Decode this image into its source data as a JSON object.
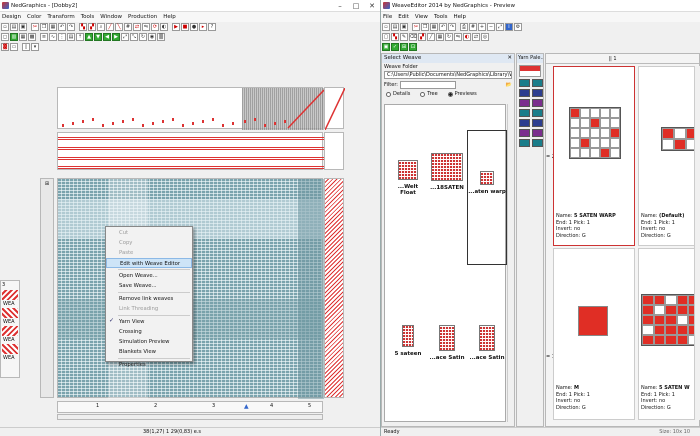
{
  "left": {
    "title": "NedGraphics - [Dobby2]",
    "menu": [
      "Design",
      "Color",
      "Transform",
      "Tools",
      "Window",
      "Production",
      "Help"
    ],
    "row_labels": [
      "3",
      "WEA",
      "WEA",
      "WEA",
      "WEA"
    ],
    "ruler_marks": [
      "1",
      "2",
      "3",
      "4",
      "5"
    ],
    "status": "38(1,27) 1 29(0,83) e.s"
  },
  "context_menu": {
    "items": [
      {
        "label": "Cut",
        "disabled": true
      },
      {
        "label": "Copy",
        "disabled": true
      },
      {
        "label": "Paste",
        "disabled": true
      },
      {
        "label": "Edit with Weave Editor",
        "highlight": true
      },
      {
        "label": "Open Weave..."
      },
      {
        "label": "Save Weave..."
      },
      {
        "label": "Remove link weaves"
      },
      {
        "label": "Link Threading",
        "disabled": true
      },
      {
        "label": "Yarn View",
        "checked": true
      },
      {
        "label": "Crossing"
      },
      {
        "label": "Simulation Preview"
      },
      {
        "label": "Blankets View"
      },
      {
        "label": "Properties"
      }
    ]
  },
  "right": {
    "title": "WeaveEditor 2014 by NedGraphics - Preview",
    "menu": [
      "File",
      "Edit",
      "View",
      "Tools",
      "Help"
    ],
    "select_weave": {
      "header": "Select Weave",
      "folder_label": "Weave Folder",
      "folder_path": "C:\\Users\\Public\\Documents\\NedGraphics\\Library\\Weaves",
      "filter_label": "Filter:",
      "modes": [
        "Details",
        "Tree",
        "Previews"
      ],
      "selected_mode": "Previews",
      "thumbs": [
        "...Welt Float",
        "...18SATEN",
        "...aten warp",
        "5 sateen",
        "...ace Satin",
        "...ace Satin"
      ]
    },
    "yarn_palette_header": "Yarn Pale...",
    "grid": {
      "col_header": "|| 1",
      "row_labels": [
        "= 2",
        "= 1"
      ],
      "cells": [
        {
          "name": "5 SATEN WARP",
          "end": "1",
          "pick": "1",
          "invert": "no",
          "direction": "G"
        },
        {
          "name": "(Default)",
          "end": "1",
          "pick": "1",
          "invert": "no",
          "direction": "G"
        },
        {
          "name": "M",
          "end": "1",
          "pick": "1",
          "invert": "no",
          "direction": "G"
        },
        {
          "name": "5 SATEN W",
          "end": "1",
          "pick": "1",
          "invert": "no",
          "direction": "G"
        }
      ],
      "field_labels": {
        "name": "Name:",
        "end": "End:",
        "pick": "Pick:",
        "invert": "Invert:",
        "direction": "Direction:"
      }
    },
    "status": "Ready",
    "status_right": "Size: 10x 10"
  }
}
